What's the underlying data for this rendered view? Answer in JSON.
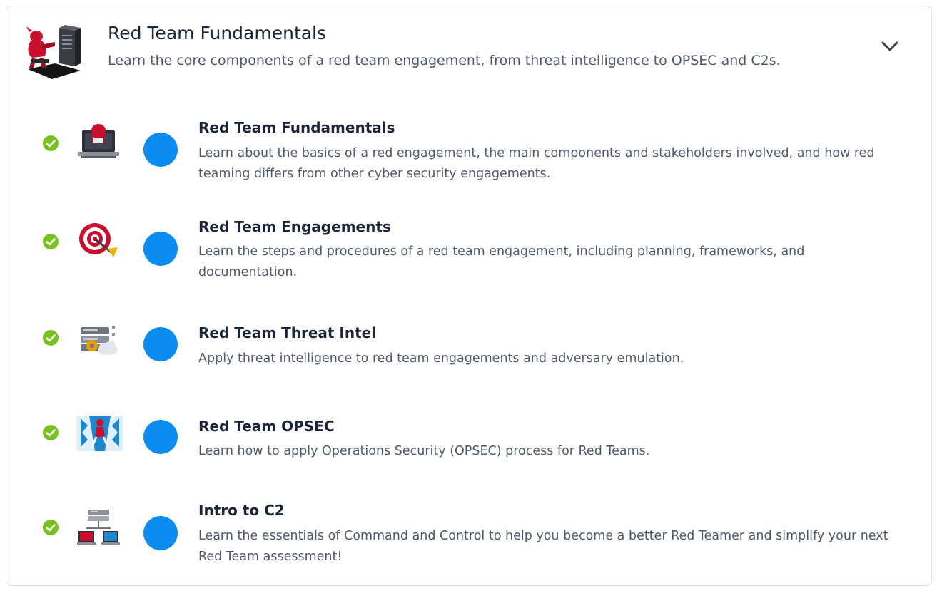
{
  "path": {
    "title": "Red Team Fundamentals",
    "description": "Learn the core components of a red team engagement, from threat intelligence to OPSEC and C2s.",
    "logo_icon": "red-hacker-server-logo",
    "expand_icon": "chevron-down-icon"
  },
  "colors": {
    "check": "#79c21e",
    "dot": "#0a8cf0",
    "title": "#1c2538",
    "desc": "#505a6b",
    "border": "#dcdfe4"
  },
  "rooms": [
    {
      "title": "Red Team Fundamentals",
      "description": "Learn about the basics of a red engagement, the main components and stakeholders involved, and how red teaming differs from other cyber security engagements.",
      "icon": "hacker-laptop-icon",
      "completed": true
    },
    {
      "title": "Red Team Engagements",
      "description": "Learn the steps and procedures of a red team engagement, including planning, frameworks, and documentation.",
      "icon": "target-icon",
      "completed": true
    },
    {
      "title": "Red Team Threat Intel",
      "description": "Apply threat intelligence to red team engagements and adversary emulation.",
      "icon": "server-gear-cloud-icon",
      "completed": true
    },
    {
      "title": "Red Team OPSEC",
      "description": "Learn how to apply Operations Security (OPSEC) process for Red Teams.",
      "icon": "opsec-climber-icon",
      "completed": true
    },
    {
      "title": "Intro to C2",
      "description": "Learn the essentials of Command and Control to help you become a better Red Teamer and simplify your next Red Team assessment!",
      "icon": "c2-network-icon",
      "completed": true
    }
  ]
}
